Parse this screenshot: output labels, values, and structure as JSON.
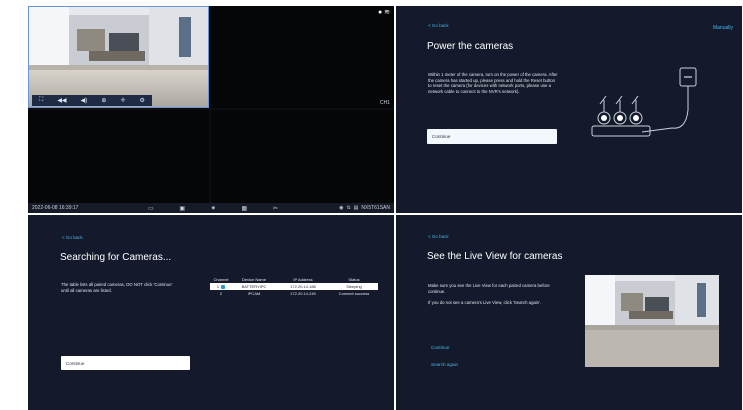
{
  "nvr": {
    "time": "2022-06-08 16:39:17",
    "camera_tag": "CH1",
    "device_id": "NX5T61SAN",
    "toolbar_icons": [
      "fullscreen-icon",
      "rewind-icon",
      "volume-icon",
      "zoom-icon",
      "ptz-icon",
      "settings-icon"
    ],
    "status_icons": [
      "monitor-icon",
      "record-icon",
      "settings-icon",
      "grid-icon",
      "tools-icon"
    ]
  },
  "power": {
    "back": "< Go back",
    "manually": "Manually",
    "title": "Power the cameras",
    "description": "Within 1 meter of the camera, turn on the power of the camera. After the camera has started up, please press and hold the Reset button to reset the camera (for devices with network ports, please use a network cable to connect to the NVR's network).",
    "continue": "Continue"
  },
  "search": {
    "back": "< Go back",
    "title": "Searching for Cameras...",
    "description": "The table lists all paired cameras, DO NOT click 'Continue' until all cameras are listed.",
    "columns": [
      "Channel",
      "Device Name",
      "IP Address",
      "Status"
    ],
    "rows": [
      {
        "channel": "1",
        "name": "BATTERYIPC",
        "ip": "172.20.14.188",
        "status": "Sleeping"
      },
      {
        "channel": "2",
        "name": "IPCAM",
        "ip": "172.20.14.249",
        "status": "Connect success"
      }
    ],
    "continue": "Continue"
  },
  "liveview": {
    "back": "< Go back",
    "title": "See the Live View for cameras",
    "description": "Make sure you see the Live View for each paired camera before continue.",
    "hint": "If you do not see a camera's Live View, click 'Search again'.",
    "continue": "Continue",
    "search_again": "Search again"
  },
  "colors": {
    "panel_bg": "#141a2b",
    "link": "#47b6e8",
    "grid_border": "#6b93d6"
  }
}
